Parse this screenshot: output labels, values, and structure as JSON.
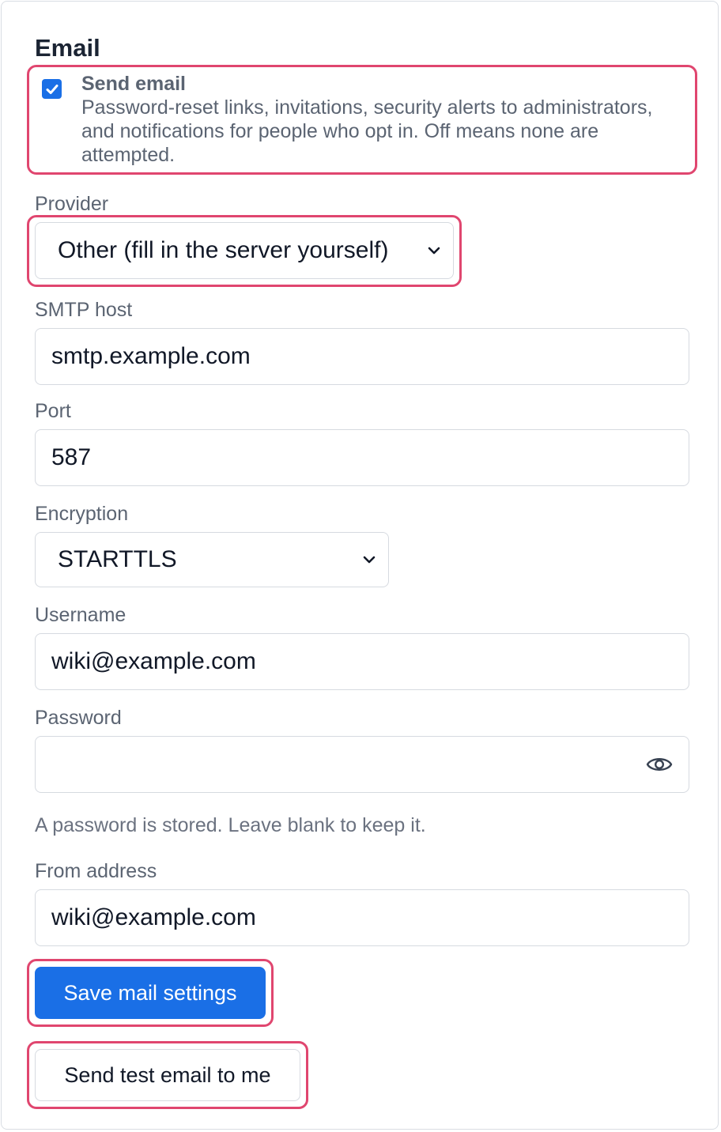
{
  "section": {
    "title": "Email"
  },
  "send_email": {
    "checked": true,
    "label": "Send email",
    "description": "Password-reset links, invitations, security alerts to administrators, and notifications for people who opt in. Off means none are attempted."
  },
  "provider": {
    "label": "Provider",
    "value": "Other (fill in the server yourself)"
  },
  "smtp_host": {
    "label": "SMTP host",
    "value": "smtp.example.com"
  },
  "port": {
    "label": "Port",
    "value": "587"
  },
  "encryption": {
    "label": "Encryption",
    "value": "STARTTLS"
  },
  "username": {
    "label": "Username",
    "value": "wiki@example.com"
  },
  "password": {
    "label": "Password",
    "value": "",
    "icon": "eye-icon",
    "note": "A password is stored. Leave blank to keep it."
  },
  "from_address": {
    "label": "From address",
    "value": "wiki@example.com"
  },
  "buttons": {
    "save_label": "Save mail settings",
    "test_label": "Send test email to me"
  },
  "colors": {
    "primary": "#1a6fe6",
    "highlight": "#e0466f",
    "muted_text": "#5b6472",
    "border": "#d6dae0"
  }
}
